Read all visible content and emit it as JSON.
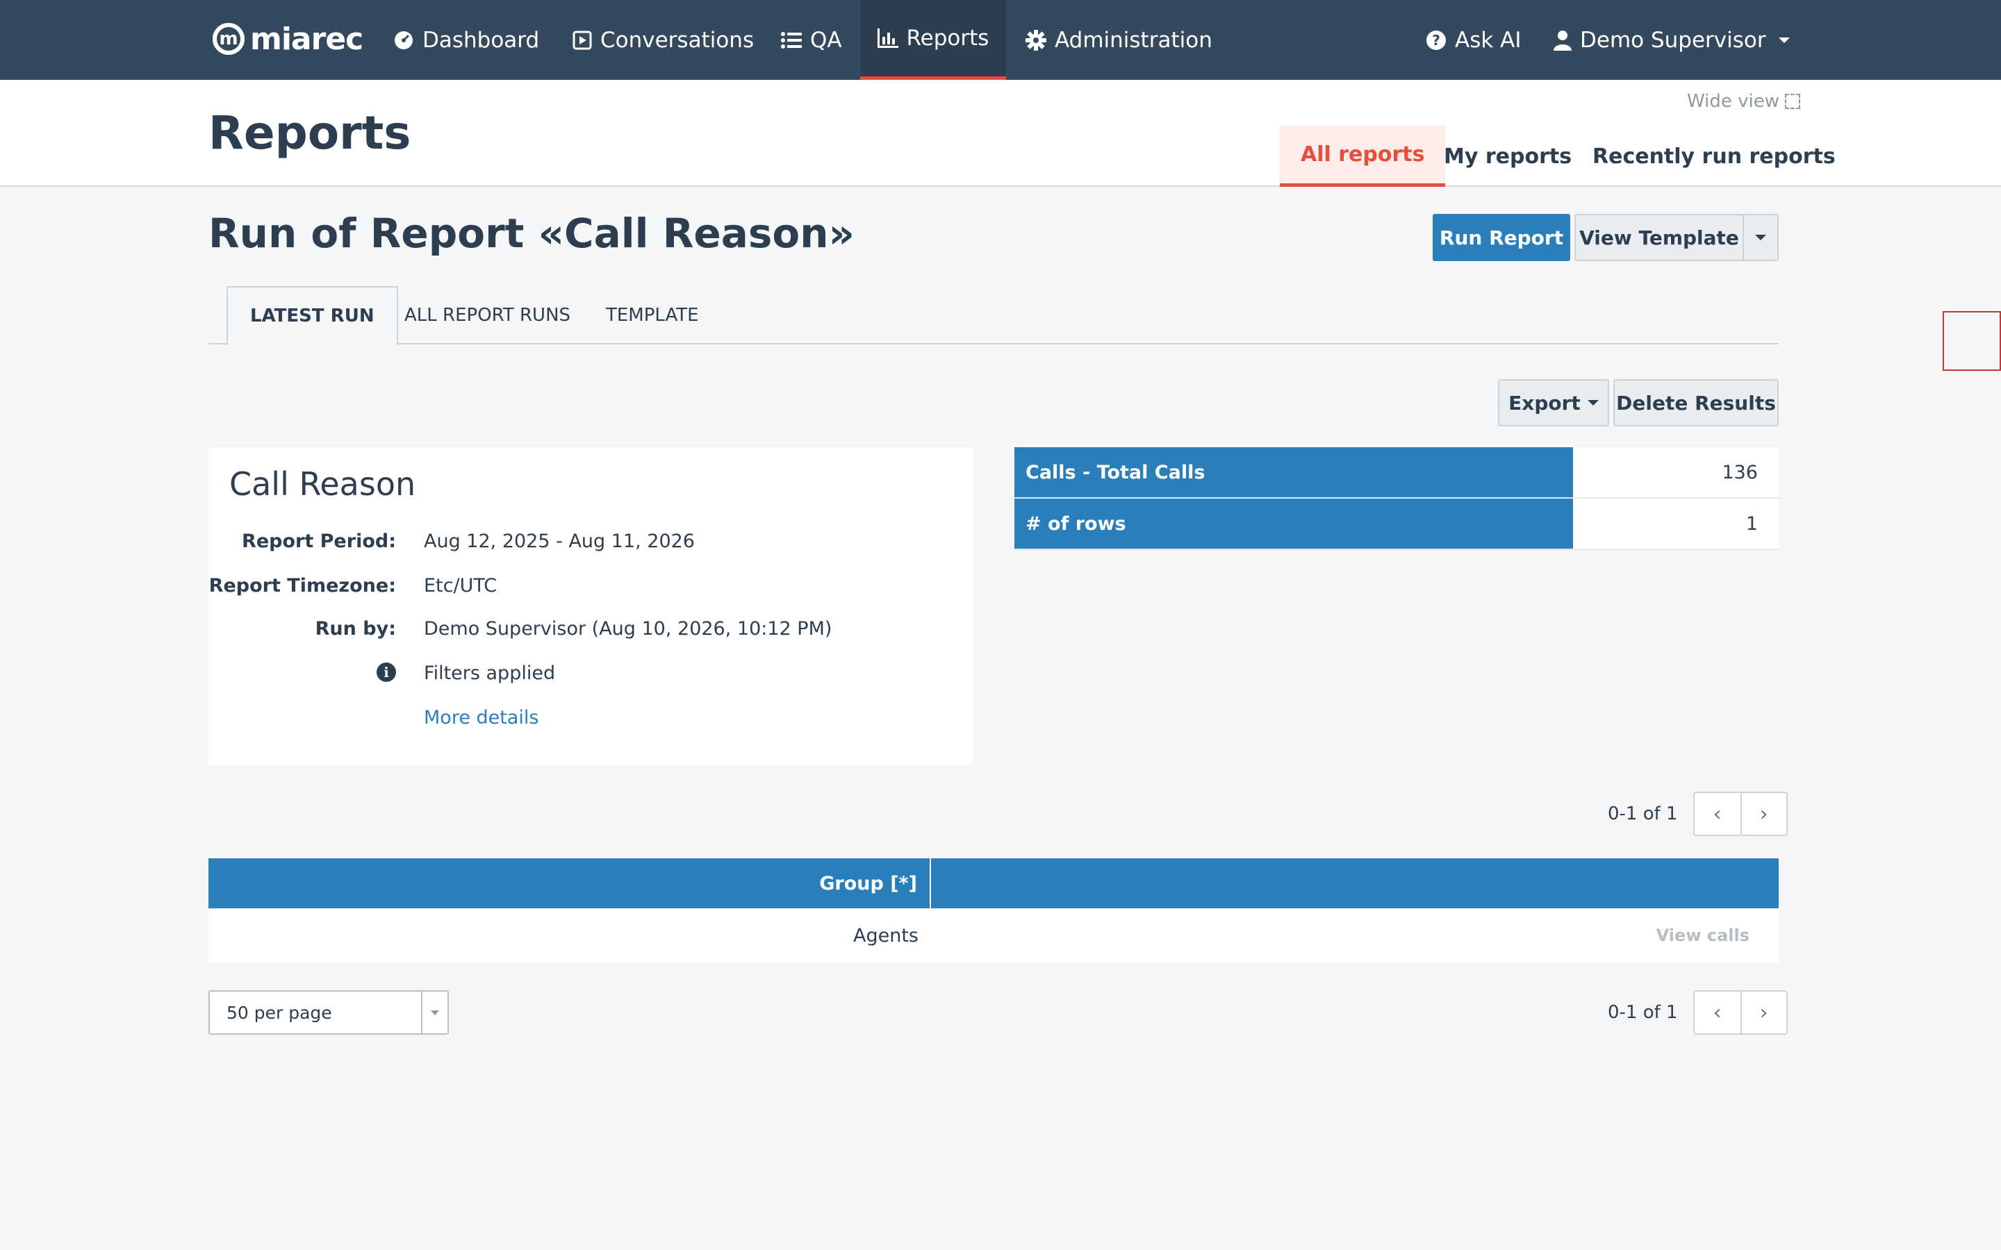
{
  "nav": {
    "brand": "miarec",
    "items": [
      {
        "label": "Dashboard",
        "icon": "dashboard-icon"
      },
      {
        "label": "Conversations",
        "icon": "play-square-icon"
      },
      {
        "label": "QA",
        "icon": "list-icon"
      },
      {
        "label": "Reports",
        "icon": "bar-chart-icon"
      },
      {
        "label": "Administration",
        "icon": "gear-icon"
      }
    ],
    "ask_ai": "Ask AI",
    "user": "Demo Supervisor"
  },
  "header": {
    "title": "Reports",
    "wide_view": "Wide view",
    "tabs": [
      "All reports",
      "My reports",
      "Recently run reports"
    ],
    "active_tab": "All reports"
  },
  "report": {
    "run_title": "Run of Report «Call Reason»",
    "run_button": "Run Report",
    "view_template_button": "View Template",
    "subtabs": [
      "LATEST RUN",
      "ALL REPORT RUNS",
      "TEMPLATE"
    ],
    "export_button": "Export",
    "delete_button": "Delete Results"
  },
  "card": {
    "title": "Call Reason",
    "period_label": "Report Period:",
    "period_value": "Aug 12, 2025 - Aug 11, 2026",
    "tz_label": "Report Timezone:",
    "tz_value": "Etc/UTC",
    "runby_label": "Run by:",
    "runby_value": "Demo Supervisor (Aug 10, 2026, 10:12 PM)",
    "filters": "Filters applied",
    "more": "More details"
  },
  "summary": [
    {
      "label": "Calls - Total Calls",
      "value": "136"
    },
    {
      "label": "# of rows",
      "value": "1"
    }
  ],
  "pager": {
    "text": "0-1 of 1"
  },
  "results": {
    "header": "Group [*]",
    "rows": [
      {
        "group": "Agents",
        "action": "View calls"
      }
    ]
  },
  "per_page": "50 per page",
  "colors": {
    "nav_bg": "#34495e",
    "accent": "#e74c3c",
    "primary": "#2a7fba"
  }
}
